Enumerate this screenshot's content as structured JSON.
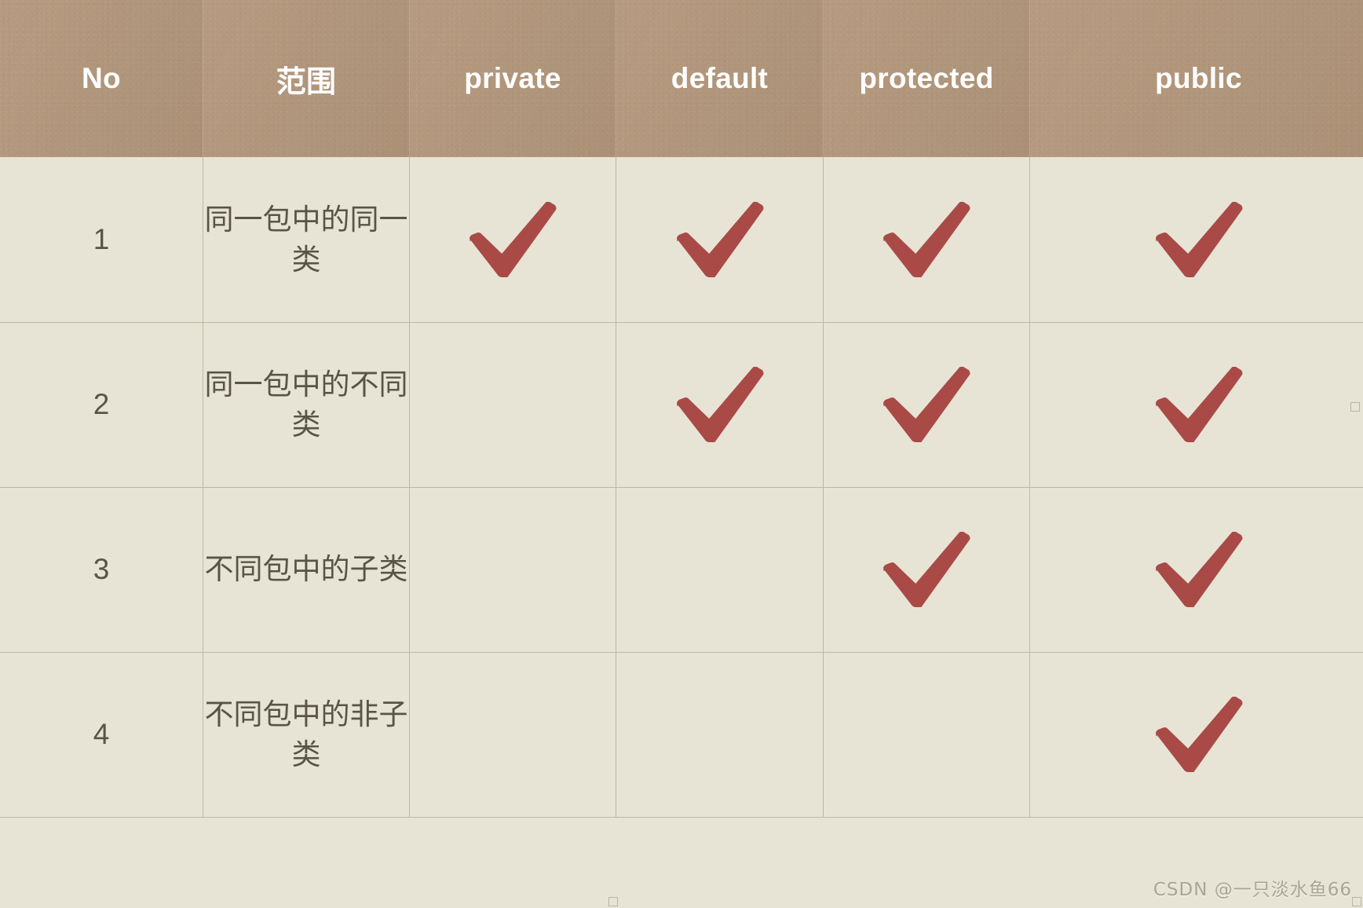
{
  "table": {
    "headers": [
      {
        "label": "No",
        "cjk": false
      },
      {
        "label": "范围",
        "cjk": true
      },
      {
        "label": "private",
        "cjk": false
      },
      {
        "label": "default",
        "cjk": false
      },
      {
        "label": "protected",
        "cjk": false
      },
      {
        "label": "public",
        "cjk": false
      }
    ],
    "rows": [
      {
        "no": "1",
        "scope": "同一包中的同一类",
        "private": true,
        "default": true,
        "protected": true,
        "public": true
      },
      {
        "no": "2",
        "scope": "同一包中的不同类",
        "private": false,
        "default": true,
        "protected": true,
        "public": true
      },
      {
        "no": "3",
        "scope": "不同包中的子类",
        "private": false,
        "default": false,
        "protected": true,
        "public": true
      },
      {
        "no": "4",
        "scope": "不同包中的非子类",
        "private": false,
        "default": false,
        "protected": false,
        "public": true
      }
    ]
  },
  "icons": {
    "check": "check-mark-icon"
  },
  "watermark": {
    "text": "CSDN @一只淡水鱼66"
  },
  "colors": {
    "header_bg": "#b2967a",
    "header_text": "#ffffff",
    "cell_bg": "#e7e4d6",
    "no_cell_bg": "#d3cdba",
    "grid_line": "#bcb8a6",
    "body_text": "#5b5748",
    "check_red": "#a94a46",
    "watermark_text": "#a9a595"
  }
}
